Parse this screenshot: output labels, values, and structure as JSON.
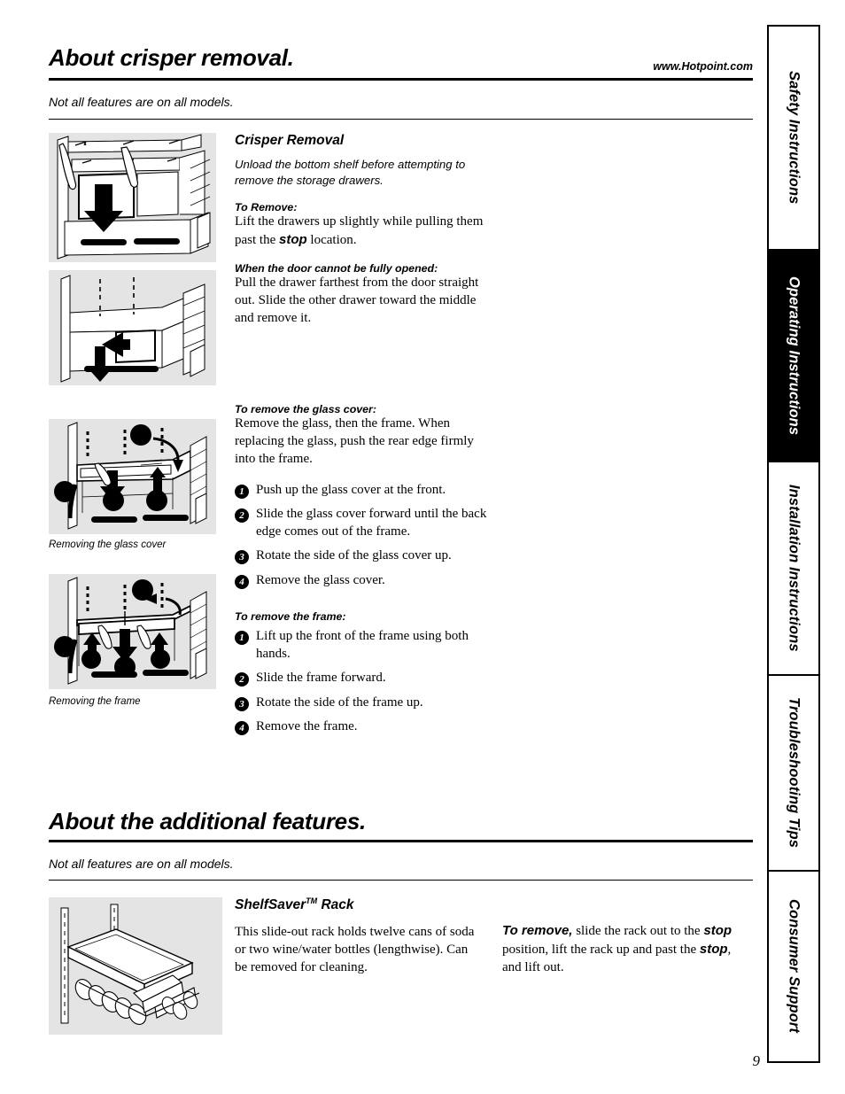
{
  "header": {
    "title": "About crisper removal.",
    "website": "www.Hotpoint.com",
    "note": "Not all features are on all models."
  },
  "section2": {
    "title": "About the additional features.",
    "note": "Not all features are on all models."
  },
  "tabs": [
    {
      "label": "Safety Instructions",
      "active": false
    },
    {
      "label": "Operating Instructions",
      "active": true
    },
    {
      "label": "Installation Instructions",
      "active": false
    },
    {
      "label": "Troubleshooting Tips",
      "active": false
    },
    {
      "label": "Consumer Support",
      "active": false
    }
  ],
  "crisper": {
    "heading": "Crisper Removal",
    "intro": "Unload the bottom shelf before attempting to remove the storage drawers.",
    "to_remove_label": "To Remove:",
    "to_remove_body_1": "Lift the drawers up slightly while pulling them past the ",
    "to_remove_stop": "stop",
    "to_remove_body_2": " location.",
    "door_label": "When the door cannot be fully opened:",
    "door_body": "Pull the drawer farthest from the door straight out. Slide the other drawer toward the middle and remove it."
  },
  "glass_cover": {
    "heading": "To remove the glass cover:",
    "intro": "Remove the glass, then the frame. When replacing the glass, push the rear edge firmly into the frame.",
    "steps": [
      {
        "num": "1",
        "text": "Push up the glass cover at the front."
      },
      {
        "num": "2",
        "text": "Slide the glass cover forward until the back edge comes out of the frame."
      },
      {
        "num": "3",
        "text": "Rotate the side of the glass cover up."
      },
      {
        "num": "4",
        "text": "Remove the glass cover."
      }
    ]
  },
  "frame": {
    "heading": "To remove the frame:",
    "steps": [
      {
        "num": "1",
        "text": "Lift up the front of the frame using both hands."
      },
      {
        "num": "2",
        "text": "Slide the frame forward."
      },
      {
        "num": "3",
        "text": "Rotate the side of the frame up."
      },
      {
        "num": "4",
        "text": "Remove the frame."
      }
    ]
  },
  "figures": {
    "crisper_lift_caption": "",
    "crisper_door_caption": "",
    "glass_cover_caption": "Removing the glass cover",
    "frame_caption": "Removing the frame",
    "shelfsaver_caption": ""
  },
  "shelfsaver": {
    "heading_name": "ShelfSaver",
    "heading_tm": "TM",
    "heading_suffix": " Rack",
    "body": "This slide-out rack holds twelve cans of soda or two wine/water bottles (lengthwise). Can be removed for cleaning.",
    "remove_label": "To remove,",
    "remove_body_1": " slide the rack out to the ",
    "remove_stop_1": "stop",
    "remove_body_2": " position, lift the rack up and past the ",
    "remove_stop_2": "stop",
    "remove_body_3": ", and lift out."
  },
  "footer": {
    "page_number": "9"
  },
  "colors": {
    "ink": "#000000",
    "figure_bg": "#e4e4e4"
  }
}
